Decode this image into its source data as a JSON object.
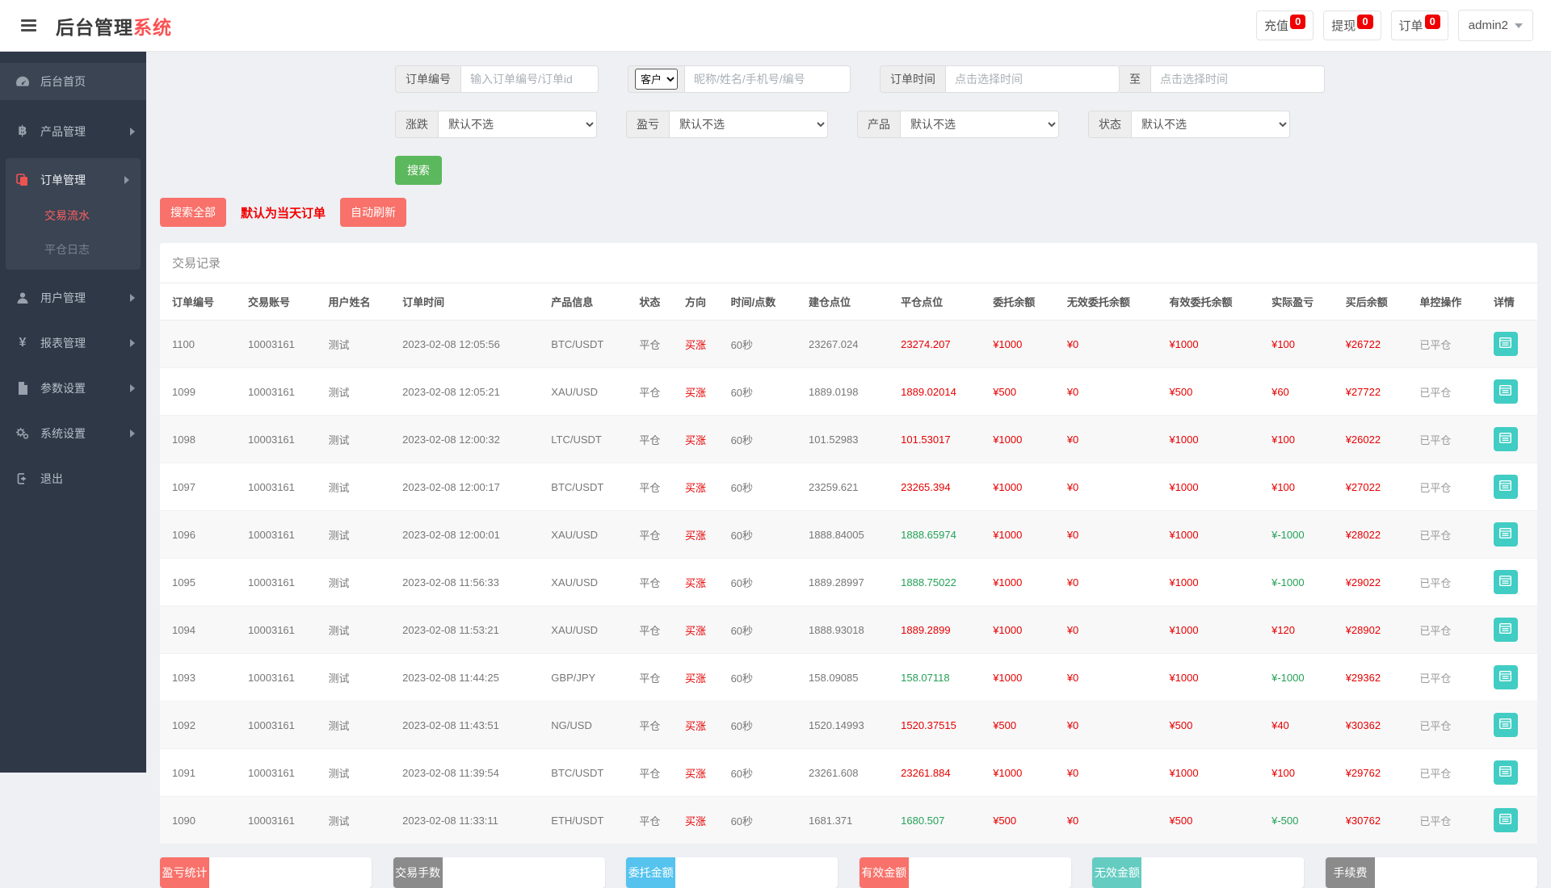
{
  "topbar": {
    "brand_prefix": "后台管理",
    "brand_suffix": "系统",
    "stats": [
      {
        "id": "recharge",
        "label": "充值",
        "badge": "0"
      },
      {
        "id": "withdraw",
        "label": "提现",
        "badge": "0"
      },
      {
        "id": "order",
        "label": "订单",
        "badge": "0"
      }
    ],
    "user_name": "admin2"
  },
  "sidebar": {
    "items": [
      {
        "id": "home",
        "label": "后台首页",
        "icon": "dashboard-icon",
        "highlight": true
      },
      {
        "id": "products",
        "label": "产品管理",
        "icon": "bitcoin-icon",
        "arrow": true
      },
      {
        "id": "orders",
        "label": "订单管理",
        "icon": "orders-icon",
        "arrow": true,
        "expanded": true,
        "children": [
          {
            "id": "trade-flow",
            "label": "交易流水",
            "active": true
          },
          {
            "id": "close-log",
            "label": "平仓日志",
            "active": false
          }
        ]
      },
      {
        "id": "users",
        "label": "用户管理",
        "icon": "user-icon",
        "arrow": true
      },
      {
        "id": "reports",
        "label": "报表管理",
        "icon": "yen-icon",
        "arrow": true
      },
      {
        "id": "params",
        "label": "参数设置",
        "icon": "params-icon",
        "arrow": true
      },
      {
        "id": "system",
        "label": "系统设置",
        "icon": "gears-icon",
        "arrow": true
      },
      {
        "id": "logout",
        "label": "退出",
        "icon": "logout-icon"
      }
    ]
  },
  "filters": {
    "order_no_label": "订单编号",
    "order_no_placeholder": "输入订单编号/订单id",
    "customer_select": "客户",
    "customer_placeholder": "昵称/姓名/手机号/编号",
    "order_time_label": "订单时间",
    "time_placeholder": "点击选择时间",
    "to_label": "至",
    "rise_fall_label": "涨跌",
    "profit_loss_label": "盈亏",
    "product_label": "产品",
    "status_label": "状态",
    "default_option": "默认不选",
    "search_button": "搜索"
  },
  "actions": {
    "search_all": "搜索全部",
    "note": "默认为当天订单",
    "auto_refresh": "自动刷新"
  },
  "table": {
    "title": "交易记录",
    "headers": [
      "订单编号",
      "交易账号",
      "用户姓名",
      "订单时间",
      "产品信息",
      "状态",
      "方向",
      "时间/点数",
      "建仓点位",
      "平仓点位",
      "委托余额",
      "无效委托余额",
      "有效委托余额",
      "实际盈亏",
      "买后余额",
      "单控操作",
      "详情"
    ],
    "rows": [
      {
        "order_no": "1100",
        "account": "10003161",
        "user": "测试",
        "time": "2023-02-08 12:05:56",
        "product": "BTC/USDT",
        "status": "平仓",
        "direction": "买涨",
        "period": "60秒",
        "open_point": "23267.024",
        "close_point": "23274.207",
        "close_trend": "up",
        "entrust": "¥1000",
        "invalid_entrust": "¥0",
        "valid_entrust": "¥1000",
        "profit": "¥100",
        "profit_trend": "up",
        "balance_after": "¥26722",
        "control": "已平仓"
      },
      {
        "order_no": "1099",
        "account": "10003161",
        "user": "测试",
        "time": "2023-02-08 12:05:21",
        "product": "XAU/USD",
        "status": "平仓",
        "direction": "买涨",
        "period": "60秒",
        "open_point": "1889.0198",
        "close_point": "1889.02014",
        "close_trend": "up",
        "entrust": "¥500",
        "invalid_entrust": "¥0",
        "valid_entrust": "¥500",
        "profit": "¥60",
        "profit_trend": "up",
        "balance_after": "¥27722",
        "control": "已平仓"
      },
      {
        "order_no": "1098",
        "account": "10003161",
        "user": "测试",
        "time": "2023-02-08 12:00:32",
        "product": "LTC/USDT",
        "status": "平仓",
        "direction": "买涨",
        "period": "60秒",
        "open_point": "101.52983",
        "close_point": "101.53017",
        "close_trend": "up",
        "entrust": "¥1000",
        "invalid_entrust": "¥0",
        "valid_entrust": "¥1000",
        "profit": "¥100",
        "profit_trend": "up",
        "balance_after": "¥26022",
        "control": "已平仓"
      },
      {
        "order_no": "1097",
        "account": "10003161",
        "user": "测试",
        "time": "2023-02-08 12:00:17",
        "product": "BTC/USDT",
        "status": "平仓",
        "direction": "买涨",
        "period": "60秒",
        "open_point": "23259.621",
        "close_point": "23265.394",
        "close_trend": "up",
        "entrust": "¥1000",
        "invalid_entrust": "¥0",
        "valid_entrust": "¥1000",
        "profit": "¥100",
        "profit_trend": "up",
        "balance_after": "¥27022",
        "control": "已平仓"
      },
      {
        "order_no": "1096",
        "account": "10003161",
        "user": "测试",
        "time": "2023-02-08 12:00:01",
        "product": "XAU/USD",
        "status": "平仓",
        "direction": "买涨",
        "period": "60秒",
        "open_point": "1888.84005",
        "close_point": "1888.65974",
        "close_trend": "down",
        "entrust": "¥1000",
        "invalid_entrust": "¥0",
        "valid_entrust": "¥1000",
        "profit": "¥-1000",
        "profit_trend": "down",
        "balance_after": "¥28022",
        "control": "已平仓"
      },
      {
        "order_no": "1095",
        "account": "10003161",
        "user": "测试",
        "time": "2023-02-08 11:56:33",
        "product": "XAU/USD",
        "status": "平仓",
        "direction": "买涨",
        "period": "60秒",
        "open_point": "1889.28997",
        "close_point": "1888.75022",
        "close_trend": "down",
        "entrust": "¥1000",
        "invalid_entrust": "¥0",
        "valid_entrust": "¥1000",
        "profit": "¥-1000",
        "profit_trend": "down",
        "balance_after": "¥29022",
        "control": "已平仓"
      },
      {
        "order_no": "1094",
        "account": "10003161",
        "user": "测试",
        "time": "2023-02-08 11:53:21",
        "product": "XAU/USD",
        "status": "平仓",
        "direction": "买涨",
        "period": "60秒",
        "open_point": "1888.93018",
        "close_point": "1889.2899",
        "close_trend": "up",
        "entrust": "¥1000",
        "invalid_entrust": "¥0",
        "valid_entrust": "¥1000",
        "profit": "¥120",
        "profit_trend": "up",
        "balance_after": "¥28902",
        "control": "已平仓"
      },
      {
        "order_no": "1093",
        "account": "10003161",
        "user": "测试",
        "time": "2023-02-08 11:44:25",
        "product": "GBP/JPY",
        "status": "平仓",
        "direction": "买涨",
        "period": "60秒",
        "open_point": "158.09085",
        "close_point": "158.07118",
        "close_trend": "down",
        "entrust": "¥1000",
        "invalid_entrust": "¥0",
        "valid_entrust": "¥1000",
        "profit": "¥-1000",
        "profit_trend": "down",
        "balance_after": "¥29362",
        "control": "已平仓"
      },
      {
        "order_no": "1092",
        "account": "10003161",
        "user": "测试",
        "time": "2023-02-08 11:43:51",
        "product": "NG/USD",
        "status": "平仓",
        "direction": "买涨",
        "period": "60秒",
        "open_point": "1520.14993",
        "close_point": "1520.37515",
        "close_trend": "up",
        "entrust": "¥500",
        "invalid_entrust": "¥0",
        "valid_entrust": "¥500",
        "profit": "¥40",
        "profit_trend": "up",
        "balance_after": "¥30362",
        "control": "已平仓"
      },
      {
        "order_no": "1091",
        "account": "10003161",
        "user": "测试",
        "time": "2023-02-08 11:39:54",
        "product": "BTC/USDT",
        "status": "平仓",
        "direction": "买涨",
        "period": "60秒",
        "open_point": "23261.608",
        "close_point": "23261.884",
        "close_trend": "up",
        "entrust": "¥1000",
        "invalid_entrust": "¥0",
        "valid_entrust": "¥1000",
        "profit": "¥100",
        "profit_trend": "up",
        "balance_after": "¥29762",
        "control": "已平仓"
      },
      {
        "order_no": "1090",
        "account": "10003161",
        "user": "测试",
        "time": "2023-02-08 11:33:11",
        "product": "ETH/USDT",
        "status": "平仓",
        "direction": "买涨",
        "period": "60秒",
        "open_point": "1681.371",
        "close_point": "1680.507",
        "close_trend": "down",
        "entrust": "¥500",
        "invalid_entrust": "¥0",
        "valid_entrust": "¥500",
        "profit": "¥-500",
        "profit_trend": "down",
        "balance_after": "¥30762",
        "control": "已平仓"
      }
    ]
  },
  "summary": [
    {
      "id": "profit-total",
      "label": "盈亏统计",
      "value": "",
      "color": "#f8716a"
    },
    {
      "id": "trade-lots",
      "label": "交易手数",
      "value": "",
      "color": "#8b8b8b"
    },
    {
      "id": "entrust-amount",
      "label": "委托金额",
      "value": "",
      "color": "#55c3ee"
    },
    {
      "id": "valid-amount",
      "label": "有效金额",
      "value": "",
      "color": "#f8716a"
    },
    {
      "id": "invalid-amount",
      "label": "无效金额",
      "value": "",
      "color": "#65ccc2"
    },
    {
      "id": "fee",
      "label": "手续费",
      "value": "",
      "color": "#8b8b8b"
    }
  ],
  "colors": {
    "up_red": "#e60000",
    "down_green": "#24a157",
    "detail_teal": "#41cdc3"
  }
}
